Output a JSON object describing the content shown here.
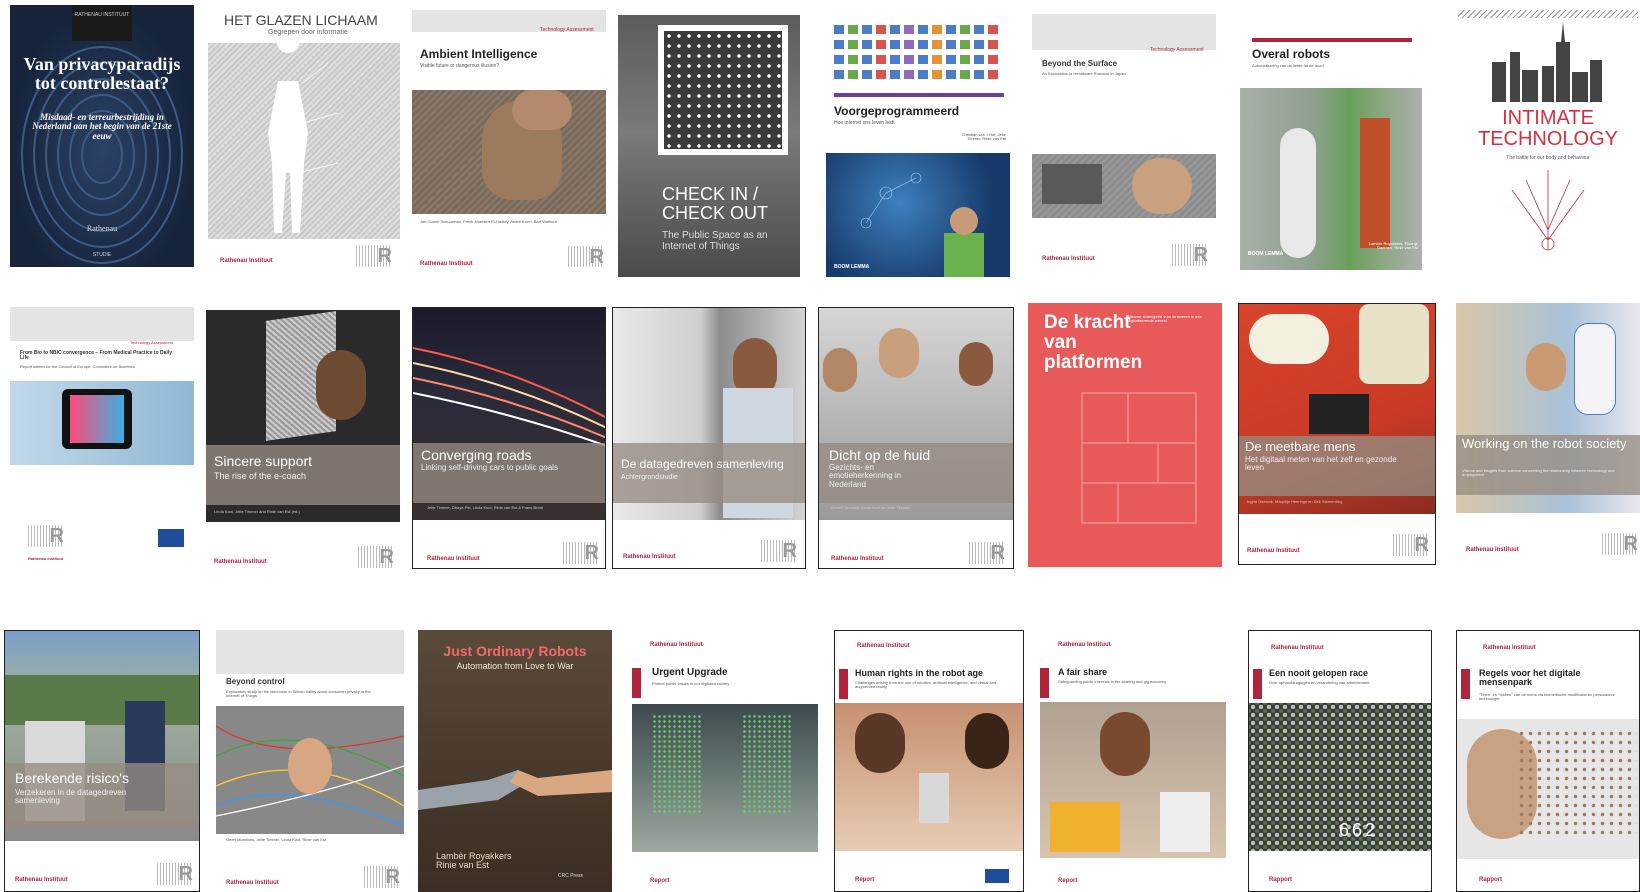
{
  "covers": {
    "c1": {
      "series": "RATHENAU INSTITUUT",
      "title": "Van privacyparadijs tot controlestaat?",
      "subtitle": "Misdaad- en terreurbestrijding in Nederland aan het begin van de 21ste eeuw",
      "publisher": "Rathenau",
      "footer": "STUDIE"
    },
    "c2": {
      "title": "HET GLAZEN LICHAAM",
      "subtitle": "Gegrepen door informatie",
      "publisher": "Rathenau Instituut"
    },
    "c3": {
      "title": "Ambient Intelligence",
      "subtitle": "Visible future or dangerous illusion?",
      "tag": "Technology Assessment",
      "authors": "Jan Gunnit Schuurman, Freek Moelaert El-Hadidy, André Krom, Bart Walhout",
      "publisher": "Rathenau Instituut"
    },
    "c4": {
      "title": "CHECK IN / CHECK OUT",
      "subtitle": "The Public Space as an Internet of Things",
      "publisher": ""
    },
    "c5": {
      "title": "Voorgeprogrammeerd",
      "subtitle": "Hoe internet ons leven leidt",
      "authors": "Christian van 't Hof, Jelte Timmer, Rinie van Est",
      "publisher": "BOOM LEMMA"
    },
    "c6": {
      "title": "Beyond the Surface",
      "subtitle": "An Exploration in Healthcare Robotics in Japan",
      "tag": "Technology Assessment",
      "publisher": "Rathenau Instituut"
    },
    "c7": {
      "title": "Overal robots",
      "subtitle": "Automatisering van de liefde tot de dood",
      "publisher": "BOOM LEMMA",
      "authors": "Lambèr Royakkers, Floortje Daemen, Rinie van Est"
    },
    "c8": {
      "title": "INTIMATE TECHNOLOGY",
      "subtitle": "The battle for our body and behaviour"
    },
    "c9": {
      "title": "From Bio to NBIC convergence – From Medical Practice to Daily Life",
      "subtitle": "Report written for the Council of Europe, Committee on Bioethics",
      "tag": "Technology Assessment",
      "publisher": "Rathenau Instituut"
    },
    "c10": {
      "title": "Sincere support",
      "subtitle": "The rise of the e-coach",
      "authors": "Linda Kool, Jelte Timmer and Rinie van Est (ed.)",
      "publisher": "Rathenau Instituut"
    },
    "c11": {
      "title": "Converging roads",
      "subtitle": "Linking self-driving cars to public goals",
      "authors": "Jelte Timmer, Dhoya Pel, Linda Kool, Rinie van Est & Frans Brom",
      "publisher": "Rathenau Instituut"
    },
    "c12": {
      "title": "De datagedreven samenleving",
      "subtitle": "Achtergrondstudie",
      "publisher": "Rathenau Instituut"
    },
    "c13": {
      "title": "Dicht op de huid",
      "subtitle": "Gezichts- en emotieherkenning in Nederland",
      "authors": "Annelli Janssen, Linda Kool en Jelte Timmer",
      "publisher": "Rathenau Instituut"
    },
    "c14": {
      "title": "De kracht van platformen",
      "subtitle": "Nieuwe strategieën voor innoveren in een digitaliserende wereld"
    },
    "c15": {
      "title": "De meetbare mens",
      "subtitle": "Het digitaal meten van het zelf en gezonde leven",
      "authors": "Ingrid Geesink, Marjolijn Heerings en Dirk Stemerding",
      "publisher": "Rathenau Instituut"
    },
    "c16": {
      "title": "Working on the robot society",
      "subtitle": "Visions and insights from science concerning the relationship between technology and employment",
      "publisher": "Rathenau Instituut"
    },
    "c17": {
      "title": "Berekende risico's",
      "subtitle": "Verzekeren in de datagedreven samenleving",
      "publisher": "Rathenau Instituut"
    },
    "c18": {
      "title": "Beyond control",
      "subtitle": "Exploratory study on the discourse in Silicon Valley about consumer privacy in the Internet of Things",
      "authors": "Geert Munnichs, Jelte Timmer, Linda Kool, Rinie van Est",
      "publisher": "Rathenau Instituut"
    },
    "c19": {
      "title": "Just Ordinary Robots",
      "subtitle": "Automation from Love to War",
      "authors": "Lambèr Royakkers Rinie van Est",
      "publisher": "CRC Press"
    },
    "c20": {
      "title": "Urgent Upgrade",
      "subtitle": "Protect public values in our digitized society",
      "publisher": "Rathenau Instituut",
      "footer": "Report"
    },
    "c21": {
      "title": "Human rights in the robot age",
      "subtitle": "Challenges arising from the use of robotics, artificial intelligence, and virtual and augmented reality",
      "publisher": "Rathenau Instituut",
      "footer": "Report"
    },
    "c22": {
      "title": "A fair share",
      "subtitle": "Safeguarding public interests in the sharing and gig economy",
      "publisher": "Rathenau Instituut",
      "footer": "Report"
    },
    "c23": {
      "title": "Een nooit gelopen race",
      "subtitle": "Over ophanddragingen en verandering van arbeidsmarkt",
      "publisher": "Rathenau Instituut",
      "footer": "Rapport",
      "numbers": "662"
    },
    "c24": {
      "title": "Regels voor het digitale mensenpark",
      "subtitle": "\"Telen\" en \"fokken\" van de mens via biomedische modificatie en persuasieve technologie",
      "publisher": "Rathenau Instituut",
      "footer": "Rapport"
    }
  },
  "colors": {
    "rathenau_red": "#b0243c",
    "platform_red": "#e8595a",
    "dark_blue": "#1d2b45"
  }
}
